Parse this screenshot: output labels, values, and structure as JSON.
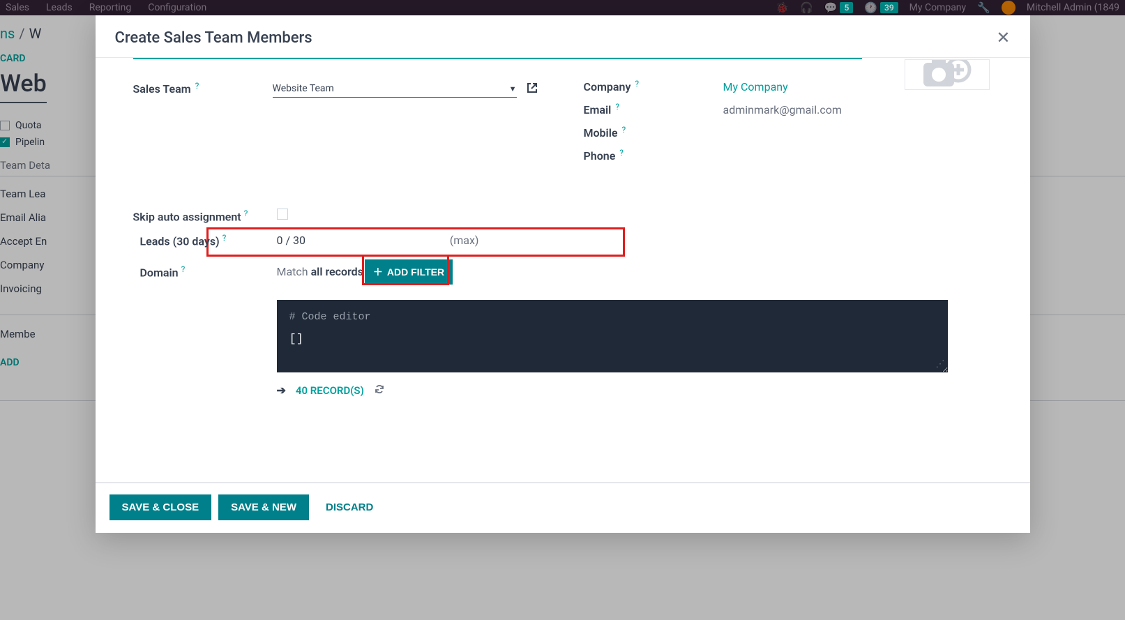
{
  "topmenu": {
    "left": [
      "Sales",
      "Leads",
      "Reporting",
      "Configuration"
    ],
    "badge1": "5",
    "badge2": "39",
    "company": "My Company",
    "user": "Mitchell Admin (1849"
  },
  "background": {
    "breadcrumb_part1": "ns",
    "breadcrumb_part2": "W",
    "card": "CARD",
    "title": "Web",
    "chk1": "Quota",
    "chk2": "Pipelin",
    "team_details": "Team Deta",
    "fields": [
      "Team Lea",
      "Email Alia",
      "Accept En",
      "Company",
      "Invoicing"
    ],
    "member": "Membe",
    "add": "ADD"
  },
  "modal": {
    "title": "Create Sales Team Members",
    "labels": {
      "sales_team": "Sales Team",
      "company": "Company",
      "email": "Email",
      "mobile": "Mobile",
      "phone": "Phone",
      "skip_auto": "Skip auto assignment",
      "leads30": "Leads (30 days)",
      "domain": "Domain"
    },
    "values": {
      "sales_team": "Website Team",
      "company": "My Company",
      "email": "adminmark@gmail.com",
      "leads_current": "0",
      "leads_max": "30",
      "leads_max_label": "(max)",
      "match_prefix": "Match ",
      "match_bold": "all records",
      "add_filter": "ADD FILTER",
      "code_comment": "# Code editor",
      "code_content": "[]",
      "records": "40 RECORD(S)"
    },
    "footer": {
      "save_close": "SAVE & CLOSE",
      "save_new": "SAVE & NEW",
      "discard": "DISCARD"
    }
  }
}
